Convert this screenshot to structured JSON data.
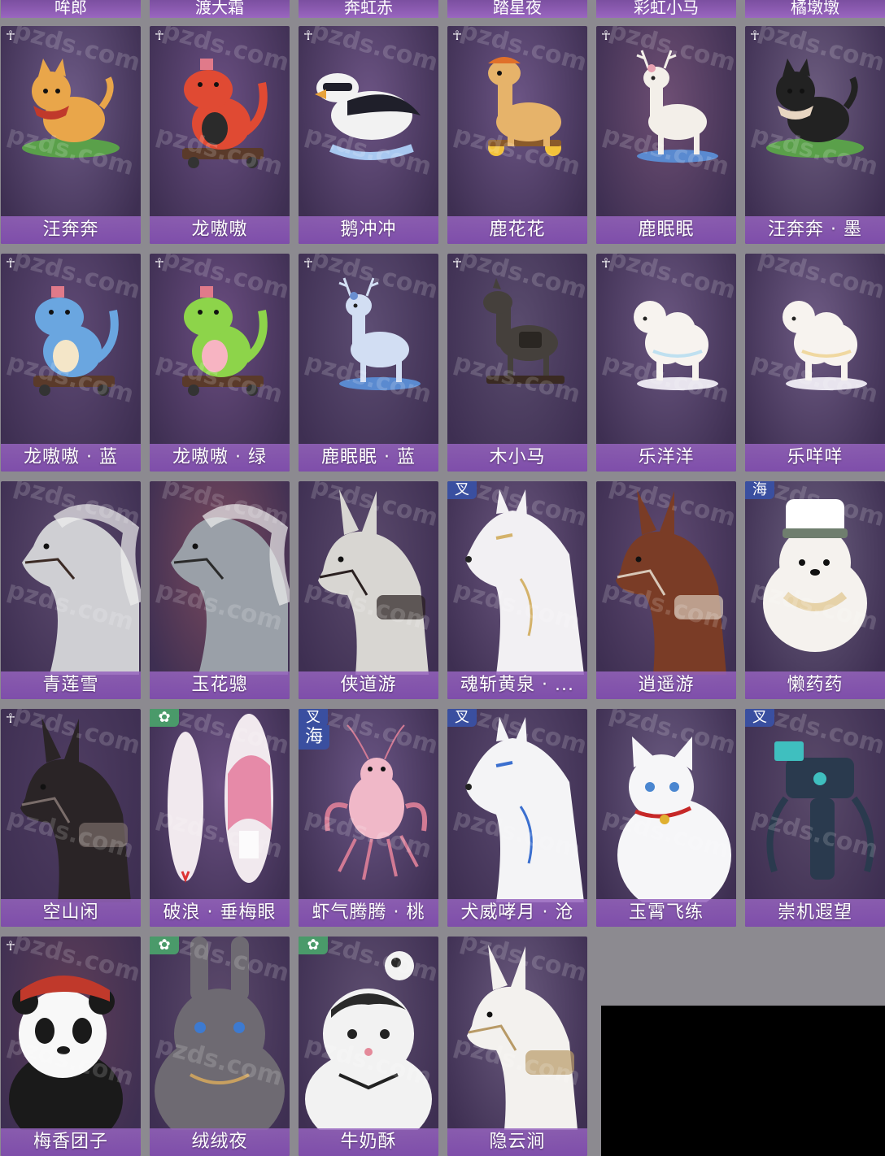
{
  "top_row": [
    "哞郎",
    "渡大霜",
    "奔虹赤",
    "踏星夜",
    "彩虹小马",
    "橘墩墩"
  ],
  "cards": [
    {
      "name": "汪奔奔",
      "tag": "crown",
      "bg": "#6d5a86",
      "art": "dog-orange",
      "c1": "#e9a64a",
      "c2": "#c0392b"
    },
    {
      "name": "龙嗷嗷",
      "tag": "crown",
      "bg": "#6a4f82",
      "art": "dino",
      "c1": "#e04a33",
      "c2": "#2b2b2b"
    },
    {
      "name": "鹅冲冲",
      "tag": "crown",
      "bg": "#6c5484",
      "art": "penguin",
      "c1": "#f2f2f2",
      "c2": "#1f1f2a"
    },
    {
      "name": "鹿花花",
      "tag": "crown",
      "bg": "#6c5585",
      "art": "giraffe",
      "c1": "#e6b36a",
      "c2": "#f3c33b"
    },
    {
      "name": "鹿眠眠",
      "tag": "crown",
      "bg": "#6e4f74",
      "art": "deer",
      "c1": "#f3efe9",
      "c2": "#e7a0b0"
    },
    {
      "name": "汪奔奔 · 墨",
      "tag": "crown",
      "bg": "#6d5d80",
      "art": "dog-black",
      "c1": "#222222",
      "c2": "#e8d6c2"
    },
    {
      "name": "龙嗷嗷 · 蓝",
      "tag": "crown",
      "bg": "#5f4a75",
      "art": "dino",
      "c1": "#6aa6e0",
      "c2": "#f4e6c8"
    },
    {
      "name": "龙嗷嗷 · 绿",
      "tag": "crown",
      "bg": "#6a4d80",
      "art": "dino",
      "c1": "#8dd44a",
      "c2": "#f7b4c2"
    },
    {
      "name": "鹿眠眠 · 蓝",
      "tag": "crown",
      "bg": "#5d4d73",
      "art": "deer",
      "c1": "#d2def3",
      "c2": "#6a8fd0"
    },
    {
      "name": "木小马",
      "tag": "crown",
      "bg": "#5a4c6e",
      "art": "horse-toy",
      "c1": "#45403c",
      "c2": "#2a2622"
    },
    {
      "name": "乐洋洋",
      "tag": "crown",
      "bg": "#6a5680",
      "art": "sheep",
      "c1": "#f7f3ef",
      "c2": "#bfe0f0"
    },
    {
      "name": "乐咩咩",
      "tag": "",
      "bg": "#6e5b84",
      "art": "sheep",
      "c1": "#f7f3ef",
      "c2": "#f0d8a0"
    },
    {
      "name": "青莲雪",
      "tag": "",
      "bg": "#5d4b6f",
      "art": "horse",
      "c1": "#cfcfd3",
      "c2": "#3b2a24"
    },
    {
      "name": "玉花骢",
      "tag": "",
      "bg": "#7a4a5e",
      "art": "horse",
      "c1": "#9aa0a8",
      "c2": "#2a2a2a"
    },
    {
      "name": "侠道游",
      "tag": "",
      "bg": "#5b4a6d",
      "art": "donkey",
      "c1": "#d8d6d2",
      "c2": "#2a2020"
    },
    {
      "name": "魂斩黄泉 · ...",
      "tag": "badge",
      "badge": "叉",
      "bg": "#6a567e",
      "art": "wolf-white",
      "c1": "#f2f0f3",
      "c2": "#d4b26a"
    },
    {
      "name": "逍遥游",
      "tag": "",
      "bg": "#5f4a72",
      "art": "donkey",
      "c1": "#7a3c26",
      "c2": "#d8c8b8"
    },
    {
      "name": "懒药药",
      "tag": "badge",
      "badge": "海",
      "bg": "#6a5e7e",
      "art": "bear",
      "c1": "#f5f2ee",
      "c2": "#6f7e6e"
    },
    {
      "name": "空山闲",
      "tag": "crown",
      "bg": "#4f3d62",
      "art": "donkey",
      "c1": "#2a2426",
      "c2": "#7a6d6a"
    },
    {
      "name": "破浪 · 垂梅眼",
      "tag": "badge-green",
      "badge": "",
      "bg": "#6a5082",
      "art": "surfboard",
      "c1": "#f1e9ee",
      "c2": "#e68aa8"
    },
    {
      "name": "虾气腾腾 · 桃",
      "tag": "badge-double",
      "badge": "叉",
      "badge2": "海",
      "bg": "#6a5584",
      "art": "shrimp",
      "c1": "#f0b8c8",
      "c2": "#d17a94"
    },
    {
      "name": "犬威哮月 · 沧",
      "tag": "badge",
      "badge": "叉",
      "bg": "#5b4a70",
      "art": "wolf-white",
      "c1": "#f4f4f6",
      "c2": "#3b6fcf"
    },
    {
      "name": "玉霄飞练",
      "tag": "",
      "bg": "#6a5a80",
      "art": "cat",
      "c1": "#f6f6f8",
      "c2": "#c62828"
    },
    {
      "name": "崇机遐望",
      "tag": "badge",
      "badge": "叉",
      "bg": "#5a4a6a",
      "art": "mech",
      "c1": "#2a3a4e",
      "c2": "#3fbfbf"
    },
    {
      "name": "梅香团子",
      "tag": "crown",
      "bg": "#5e3e58",
      "art": "panda",
      "c1": "#f8f8f8",
      "c2": "#1a1a1a"
    },
    {
      "name": "绒绒夜",
      "tag": "badge-green",
      "badge": "",
      "bg": "#5c4a6c",
      "art": "rabbit",
      "c1": "#6e6a72",
      "c2": "#3d7ad0"
    },
    {
      "name": "牛奶酥",
      "tag": "badge-green",
      "badge": "",
      "bg": "#5e4e70",
      "art": "cow-cat",
      "c1": "#f2f2f2",
      "c2": "#2a2a2a"
    },
    {
      "name": "隐云涧",
      "tag": "",
      "bg": "#6a5a7e",
      "art": "donkey",
      "c1": "#f3f1ee",
      "c2": "#b89a66"
    }
  ],
  "watermark": "pzds.com",
  "crown_icon": "wings-icon"
}
